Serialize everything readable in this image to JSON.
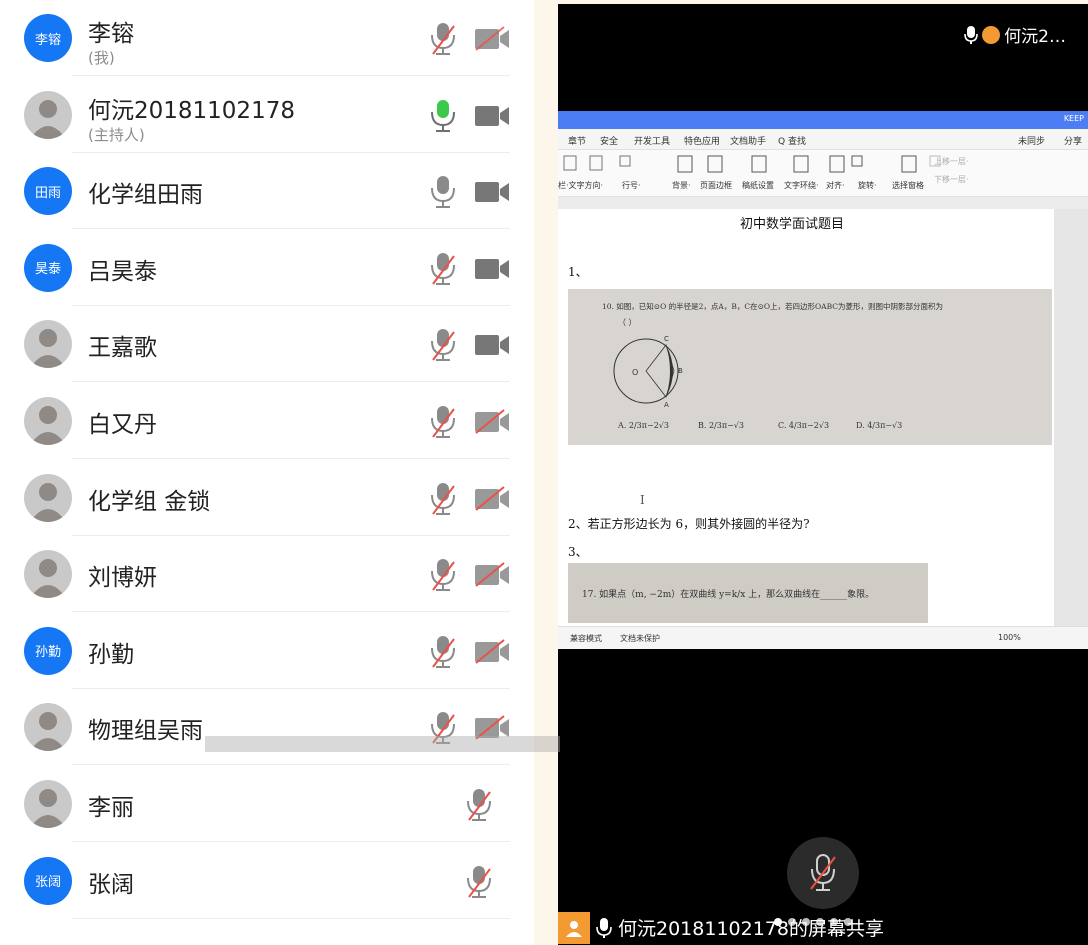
{
  "participants": [
    {
      "name": "李镕",
      "sub": "(我)",
      "avatar_text": "李镕",
      "avatar_type": "text",
      "mic": "muted",
      "camera": "off-light"
    },
    {
      "name": "何沅20181102178",
      "sub": "(主持人)",
      "avatar_type": "photo",
      "mic": "active",
      "camera": "on"
    },
    {
      "name": "化学组田雨",
      "avatar_text": "田雨",
      "avatar_type": "text",
      "mic": "on",
      "camera": "on"
    },
    {
      "name": "吕昊泰",
      "avatar_text": "昊泰",
      "avatar_type": "text",
      "mic": "muted",
      "camera": "on"
    },
    {
      "name": "王嘉歌",
      "avatar_type": "photo",
      "mic": "muted",
      "camera": "on"
    },
    {
      "name": "白又丹",
      "avatar_type": "photo",
      "mic": "muted",
      "camera": "off"
    },
    {
      "name": "化学组 金锁",
      "avatar_type": "photo",
      "mic": "muted",
      "camera": "off"
    },
    {
      "name": "刘博妍",
      "avatar_type": "photo",
      "mic": "muted",
      "camera": "off"
    },
    {
      "name": "孙勤",
      "avatar_text": "孙勤",
      "avatar_type": "text",
      "mic": "muted",
      "camera": "off"
    },
    {
      "name": "物理组吴雨",
      "avatar_type": "photo",
      "mic": "muted",
      "camera": "off"
    },
    {
      "name": "李丽",
      "avatar_type": "photo",
      "mic": "muted",
      "camera": "none"
    },
    {
      "name": "张阔",
      "avatar_text": "张阔",
      "avatar_type": "text",
      "mic": "muted",
      "camera": "none"
    }
  ],
  "share": {
    "top_label": "何沅2…",
    "bottom_label": "何沅20181102178的屏幕共享",
    "page_dots": 6,
    "active_dot": 0
  },
  "document": {
    "keep_label": "KEEP",
    "menu": [
      "章节",
      "安全",
      "开发工具",
      "特色应用",
      "文档助手",
      "Q 查找"
    ],
    "sync_label": "未同步",
    "share_label": "分享",
    "ribbon": [
      "栏·文字方向·",
      "行号·",
      "背景·",
      "页面边框",
      "稿纸设置",
      "文字环绕·",
      "对齐·",
      "旋转·",
      "选择窗格",
      "上移一层·",
      "下移一层·"
    ],
    "title": "初中数学面试题目",
    "q1_label": "1、",
    "q1_text": "10. 如图，已知⊙O 的半径是2，点A，B，C在⊙O上，若四边形OABC为菱形，则图中阴影部分面积为",
    "q1_bracket": "（    ）",
    "q1_options": [
      "A. 2/3π−2√3",
      "B. 2/3π−√3",
      "C. 4/3π−2√3",
      "D. 4/3π−√3"
    ],
    "cursor": "I",
    "q2": "2、若正方形边长为 6，则其外接圆的半径为?",
    "q3_label": "3、",
    "q3_text": "17. 如果点（m, −2m）在双曲线 y=k/x 上，那么双曲线在______象限。",
    "status_left": "兼容模式",
    "status_protect": "文档未保护",
    "zoom": "100%"
  },
  "colors": {
    "accent": "#1677f5",
    "mic_active": "#3cc84a",
    "muted_red": "#e8524a",
    "icon_gray": "#8a8a8a",
    "presenter": "#f39a33"
  }
}
